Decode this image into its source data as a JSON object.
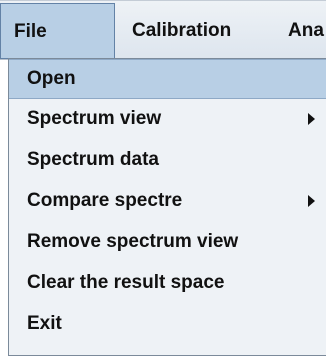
{
  "menubar": {
    "menus": [
      {
        "label": "File"
      },
      {
        "label": "Calibration"
      },
      {
        "label": "Ana"
      }
    ]
  },
  "file_menu": {
    "items": [
      {
        "label": "Open",
        "selected": true,
        "has_submenu": false
      },
      {
        "label": "Spectrum view",
        "selected": false,
        "has_submenu": true
      },
      {
        "label": "Spectrum data",
        "selected": false,
        "has_submenu": false
      },
      {
        "label": "Compare spectre",
        "selected": false,
        "has_submenu": true
      },
      {
        "label": "Remove spectrum view",
        "selected": false,
        "has_submenu": false
      },
      {
        "label": "Clear the result space",
        "selected": false,
        "has_submenu": false
      },
      {
        "label": "Exit",
        "selected": false,
        "has_submenu": false
      }
    ],
    "submenu_arrow_icon": "triangle-right-icon"
  },
  "colors": {
    "menubar_bg": "#dde5ee",
    "menu_bg": "#eef2f6",
    "selection_bg": "#b8cfe5",
    "selection_border": "#6382a6",
    "text": "#111111"
  }
}
